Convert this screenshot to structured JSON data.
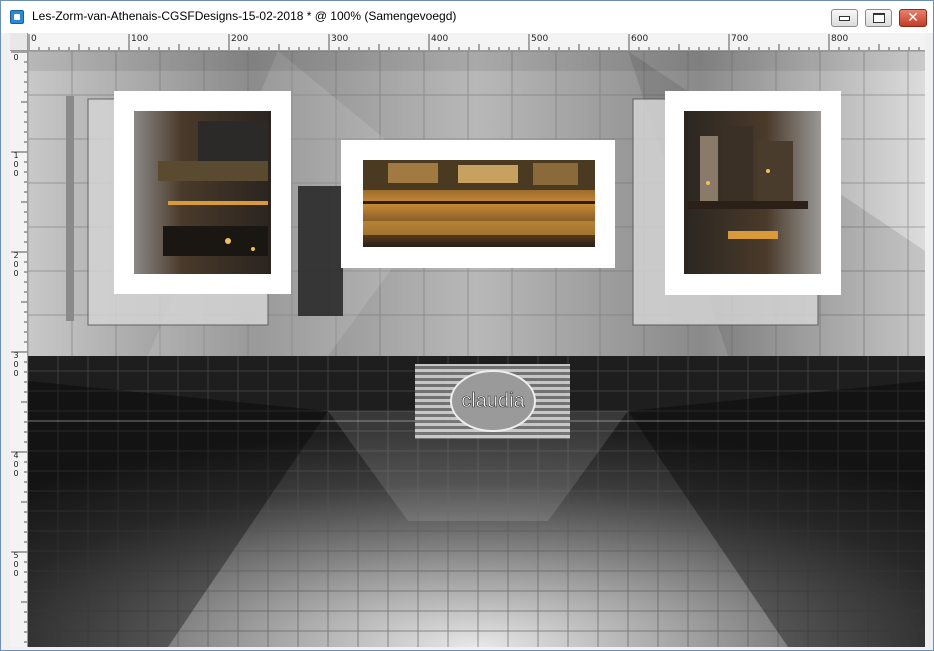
{
  "window": {
    "title": "Les-Zorm-van-Athenais-CGSFDesigns-15-02-2018 * @ 100% (Samengevoegd)",
    "buttons": {
      "minimize": "minimize",
      "maximize": "maximize",
      "close": "close"
    }
  },
  "ruler": {
    "horizontal": [
      "0",
      "100",
      "200",
      "300",
      "400",
      "500",
      "600",
      "700",
      "800"
    ],
    "vertical": [
      "0",
      "100",
      "200",
      "300",
      "400",
      "500"
    ]
  },
  "artwork": {
    "watermark_text": "claudia",
    "colors": {
      "wall": "#9a9a9a",
      "floor": "#3a3a3a",
      "frame": "#ffffff",
      "city_light": "#d99a3a"
    }
  }
}
